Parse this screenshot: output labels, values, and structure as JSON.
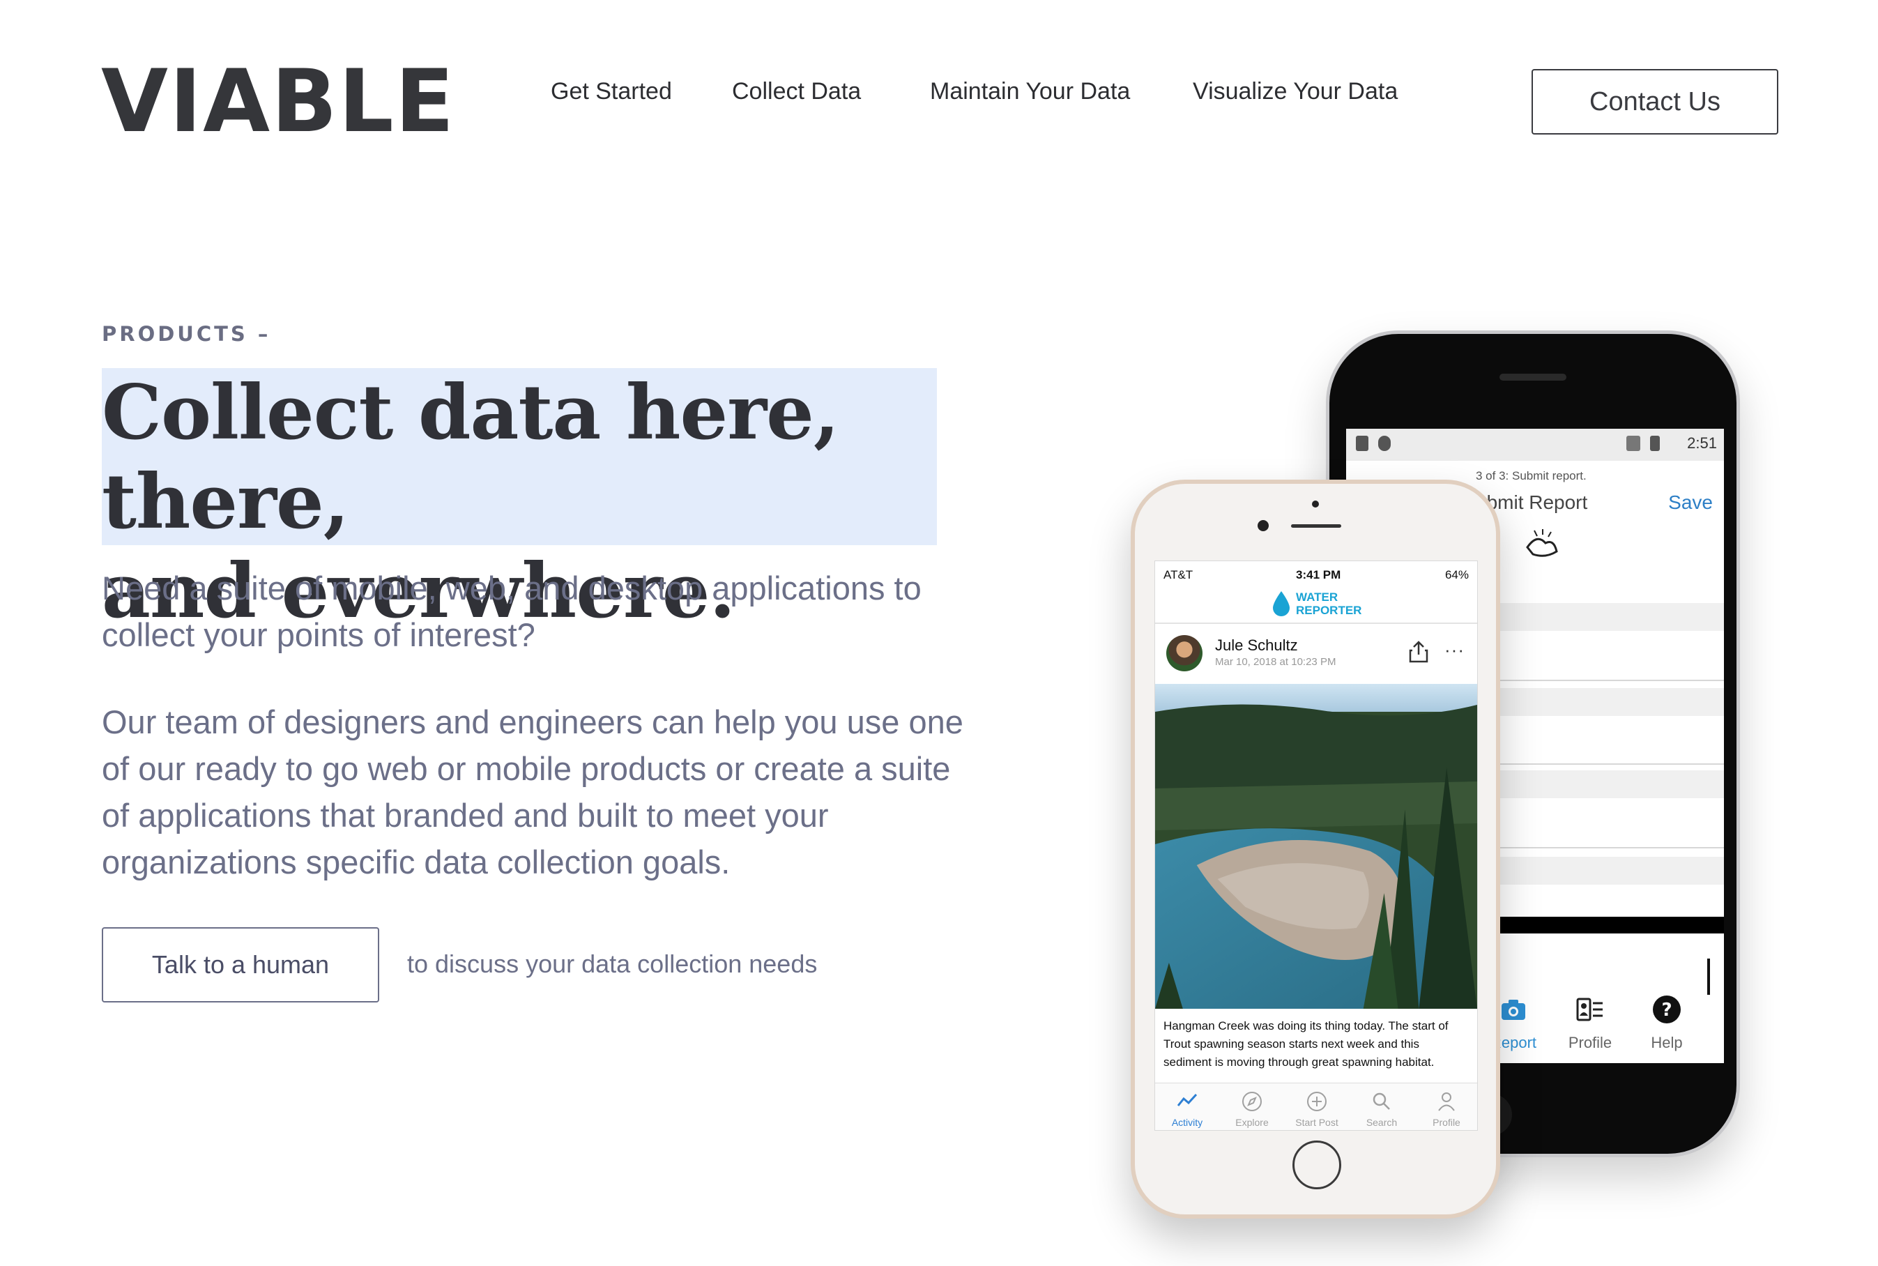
{
  "brand": {
    "logo": "VIABLE"
  },
  "nav": {
    "items": [
      {
        "label": "Get Started"
      },
      {
        "label": "Collect Data"
      },
      {
        "label": "Maintain Your Data"
      },
      {
        "label": "Visualize Your Data"
      }
    ],
    "contact_label": "Contact Us"
  },
  "hero": {
    "eyebrow": "PRODUCTS –",
    "headline_line1": "Collect data here, there,",
    "headline_line2": "and everwhere.",
    "lead": "Need a suite of mobile, web, and desktop applications to collect your points of interest?",
    "body": "Our team of designers and engineers can help you use one of our ready to go web or mobile products or create a suite of applications that branded and built to meet your organizations specific data collection goals.",
    "cta_label": "Talk to a human",
    "cta_note": "to discuss your data collection needs",
    "highlight_color": "#e3ecfb"
  },
  "back_phone": {
    "status_time": "2:51",
    "step": "3 of 3: Submit report.",
    "title": "ubmit Report",
    "save": "Save",
    "tabs": [
      {
        "label": "Report",
        "icon": "camera-icon",
        "active": true
      },
      {
        "label": "Profile",
        "icon": "profile-card-icon",
        "active": false
      },
      {
        "label": "Help",
        "icon": "help-icon",
        "active": false
      }
    ]
  },
  "front_phone": {
    "carrier": "AT&T",
    "time": "3:41 PM",
    "battery": "64%",
    "app_name_line1": "WATER",
    "app_name_line2": "REPORTER",
    "author": "Jule Schultz",
    "date": "Mar 10, 2018 at 10:23 PM",
    "caption": "Hangman Creek was doing its thing today.  The start of Trout spawning season starts next week and this sediment is moving through great spawning habitat.",
    "tabs": [
      {
        "label": "Activity",
        "icon": "activity-icon",
        "active": true
      },
      {
        "label": "Explore",
        "icon": "compass-icon",
        "active": false
      },
      {
        "label": "Start Post",
        "icon": "plus-circle-icon",
        "active": false
      },
      {
        "label": "Search",
        "icon": "search-icon",
        "active": false
      },
      {
        "label": "Profile",
        "icon": "person-icon",
        "active": false
      }
    ],
    "accent_color": "#1aa3d4"
  }
}
